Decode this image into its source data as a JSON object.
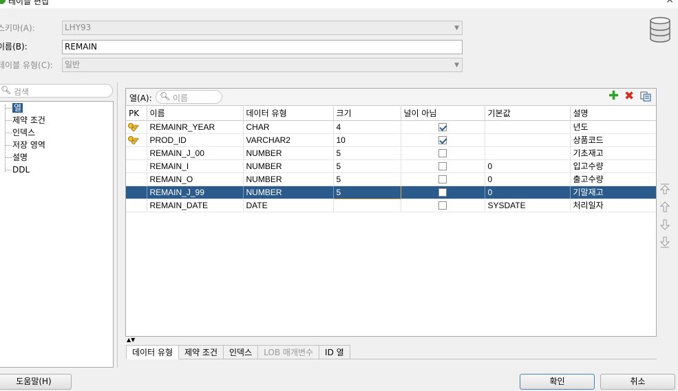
{
  "window": {
    "title": "테이블 편집",
    "close_glyph": "×"
  },
  "form": {
    "schema_label": "스키마(A):",
    "schema_value": "LHY93",
    "name_label": "이름(B):",
    "name_value": "REMAIN",
    "table_type_label": "테이블 유형(C):",
    "table_type_value": "일반"
  },
  "left": {
    "search_placeholder": "검색",
    "tree": [
      {
        "label": "열",
        "selected": true
      },
      {
        "label": "제약 조건"
      },
      {
        "label": "인덱스"
      },
      {
        "label": "저장 영역"
      },
      {
        "label": "설명"
      },
      {
        "label": "DDL"
      }
    ]
  },
  "columns_panel": {
    "label": "열(A):",
    "search_placeholder": "이름",
    "headers": [
      "PK",
      "이름",
      "데이터 유형",
      "크기",
      "널이 아님",
      "기본값",
      "설명"
    ],
    "rows": [
      {
        "pk": true,
        "name": "REMAINR_YEAR",
        "type": "CHAR",
        "size": "4",
        "not_null": true,
        "default": "",
        "comment": "년도"
      },
      {
        "pk": true,
        "name": "PROD_ID",
        "type": "VARCHAR2",
        "size": "10",
        "not_null": true,
        "default": "",
        "comment": "상품코드"
      },
      {
        "pk": false,
        "name": "REMAIN_J_00",
        "type": "NUMBER",
        "size": "5",
        "not_null": false,
        "default": "",
        "comment": "기초재고"
      },
      {
        "pk": false,
        "name": "REMAIN_I",
        "type": "NUMBER",
        "size": "5",
        "not_null": false,
        "default": "0",
        "comment": "입고수량"
      },
      {
        "pk": false,
        "name": "REMAIN_O",
        "type": "NUMBER",
        "size": "5",
        "not_null": false,
        "default": "0",
        "comment": "출고수량"
      },
      {
        "pk": false,
        "name": "REMAIN_J_99",
        "type": "NUMBER",
        "size": "5",
        "not_null": false,
        "default": "0",
        "comment": "기말재고",
        "selected": true
      },
      {
        "pk": false,
        "name": "REMAIN_DATE",
        "type": "DATE",
        "size": "",
        "not_null": false,
        "default": "SYSDATE",
        "comment": "처리일자"
      }
    ],
    "tabs": [
      {
        "label": "데이터 유형"
      },
      {
        "label": "제약 조건"
      },
      {
        "label": "인덱스"
      },
      {
        "label": "LOB 매개변수",
        "disabled": true
      },
      {
        "label": "ID 열"
      }
    ]
  },
  "icons": {
    "add": "plus-icon",
    "delete": "delete-icon",
    "copy": "copy-icon",
    "search": "search-icon",
    "database": "database-icon",
    "key": "key-icon"
  },
  "buttons": {
    "help": "도움말(H)",
    "ok": "확인",
    "cancel": "취소"
  },
  "colors": {
    "selection": "#2b5b8c",
    "add": "#2ea12e",
    "delete": "#d62b1f",
    "edit_border": "#e3a640"
  }
}
